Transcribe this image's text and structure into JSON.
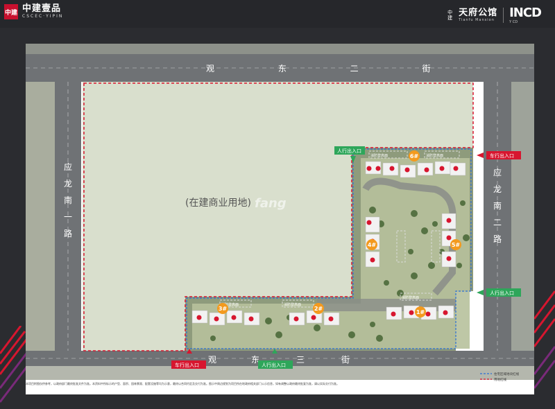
{
  "header": {
    "left_logo_mark": "中建",
    "left_logo_cn": "中建壹品",
    "left_logo_en": "CSCEC·YIPIN",
    "right_brand_prefix": "中建",
    "right_brand_cn": "天府公馆",
    "right_brand_en": "Tianfu Mansion",
    "right_logo": "INCD",
    "right_logo_sub": "Y CD"
  },
  "map": {
    "roads": {
      "north": "观 东 二 街",
      "south_left": "观",
      "south_mid": "东",
      "south_right": "三",
      "south_far": "街",
      "west": [
        "应",
        "龙",
        "南",
        "一",
        "路"
      ],
      "east": [
        "应",
        "龙",
        "南",
        "二",
        "路"
      ]
    },
    "commercial_label": "(在建商业用地)",
    "watermark": "fang",
    "buildings": [
      "6#",
      "4#",
      "5#",
      "3#",
      "2#",
      "1#"
    ],
    "fire_lane_label": "消防登高面",
    "entrances": {
      "pedestrian_top": "人行出入口",
      "vehicle_east": "车行出入口",
      "pedestrian_east": "人行出入口",
      "vehicle_south": "车行出入口",
      "pedestrian_south": "人行出入口"
    },
    "legend": [
      "住宅区域地块红线",
      "用地红线"
    ],
    "disclaimer": "本项目附图仅供参考，以政府部门最终批准文件为准。本资料中所标示的户型、面积、园林景观、配套设施等均为示意，最终以合同约定及交付为准。图示中周边规划为项目所在地政府相关部门公示信息，如有调整以政府最终批复为准，请以实际交付为准。"
  },
  "colors": {
    "accent_red": "#d7162f",
    "accent_green": "#2ea65a",
    "orange_badge": "#f39a1e",
    "panel_bg": "#ffffff",
    "land_bg": "#d9dfcd"
  }
}
